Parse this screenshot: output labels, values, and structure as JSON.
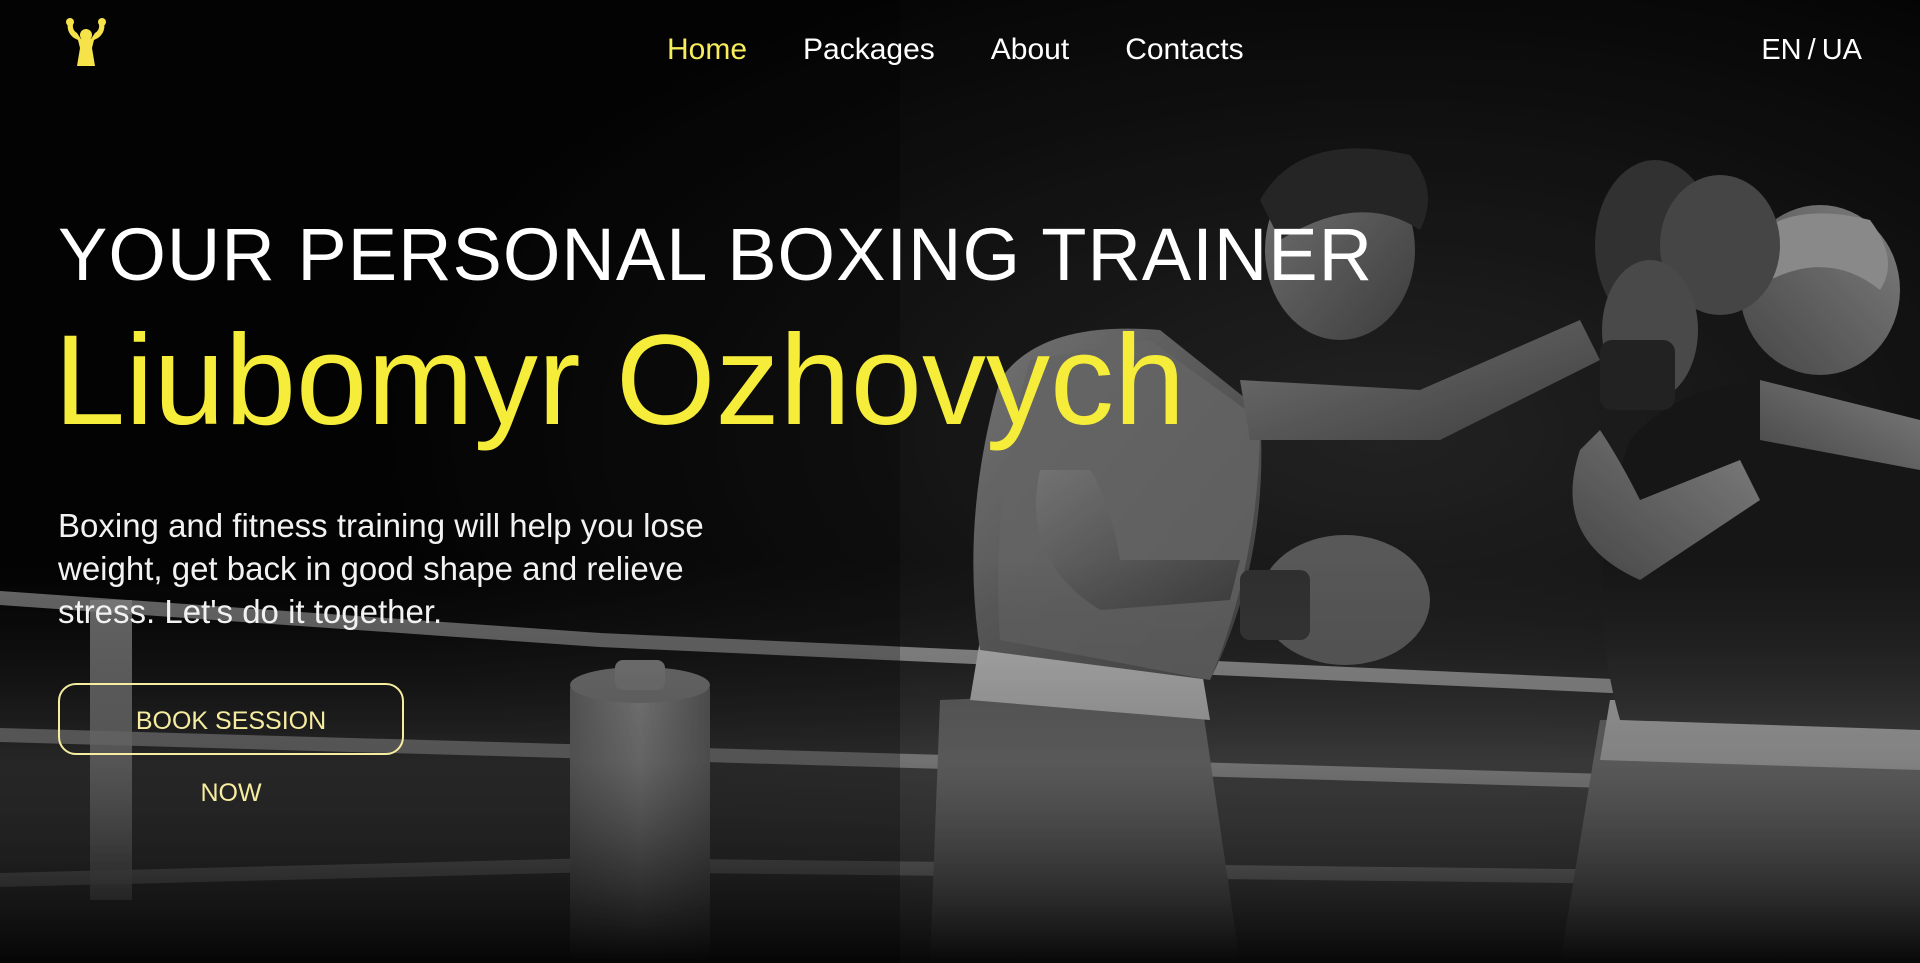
{
  "header": {
    "logo_icon": "flexing-strongman-icon",
    "nav": [
      {
        "label": "Home",
        "active": true
      },
      {
        "label": "Packages",
        "active": false
      },
      {
        "label": "About",
        "active": false
      },
      {
        "label": "Contacts",
        "active": false
      }
    ],
    "language": {
      "en": "EN",
      "separator": "/",
      "ua": "UA"
    }
  },
  "hero": {
    "title": "YOUR PERSONAL BOXING TRAINER",
    "name": "Liubomyr Ozhovych",
    "description": "Boxing and fitness training will help you lose weight, get back in good shape and relieve stress. Let's do it together.",
    "cta_label": "BOOK SESSION NOW",
    "background_image": "boxers-in-ring-photo"
  },
  "colors": {
    "accent": "#f6ec3a",
    "nav_active": "#f7ec5c",
    "cta_border": "#f6eda0",
    "background": "#050505",
    "text": "#ffffff"
  }
}
